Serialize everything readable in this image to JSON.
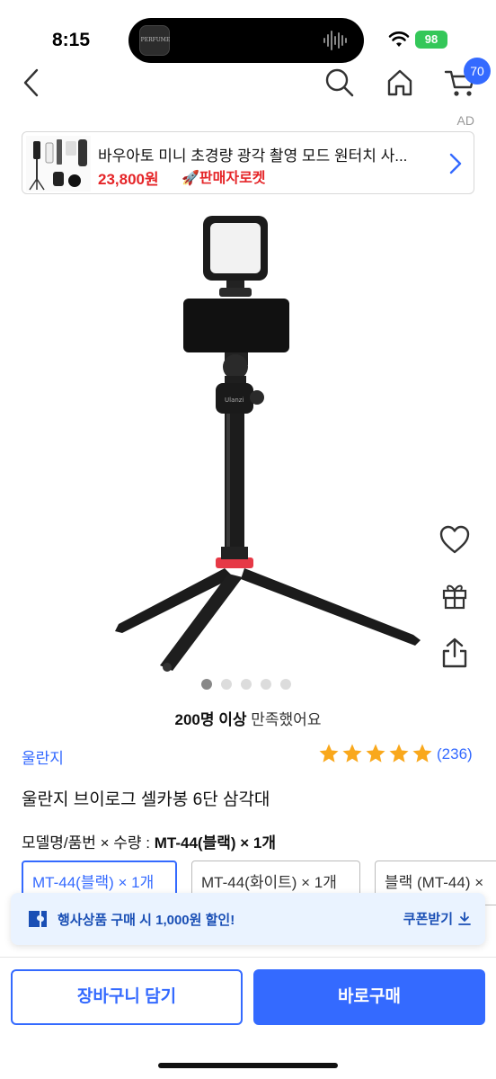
{
  "status_bar": {
    "time": "8:15",
    "battery": "98",
    "island_thumb_text": "PERFUME"
  },
  "nav": {
    "cart_count": "70"
  },
  "ad": {
    "label": "AD",
    "title": "바우아토 미니 초경량 광각 촬영 모드 원터치 사...",
    "price": "23,800원",
    "seller_badge": "🚀판매자로켓"
  },
  "product": {
    "satisfaction_count": "200명 이상",
    "satisfaction_text": "만족했어요",
    "brand": "울란지",
    "rating": 5,
    "review_count": "(236)",
    "title": "울란지 브이로그 셀카봉 6단 삼각대",
    "image_count": 5,
    "active_image": 1
  },
  "options": {
    "label": "모델명/품번 × 수량 : ",
    "selected_summary": "MT-44(블랙) × 1개",
    "chips": [
      {
        "label": "MT-44(블랙) × 1개",
        "selected": true
      },
      {
        "label": "MT-44(화이트) × 1개",
        "selected": false
      },
      {
        "label": "블랙 (MT-44) ×",
        "selected": false
      }
    ]
  },
  "coupon": {
    "text": "행사상품 구매 시 1,000원 할인!",
    "button": "쿠폰받기"
  },
  "actions": {
    "add_to_cart": "장바구니 담기",
    "buy_now": "바로구매"
  },
  "colors": {
    "accent": "#346aff",
    "price_red": "#e52528",
    "star": "#f9a81c",
    "battery": "#34c759"
  },
  "icons": [
    "back-icon",
    "search-icon",
    "home-icon",
    "cart-icon",
    "heart-icon",
    "gift-icon",
    "share-icon",
    "coupon-icon",
    "download-icon",
    "chevron-right-icon",
    "wifi-icon"
  ]
}
